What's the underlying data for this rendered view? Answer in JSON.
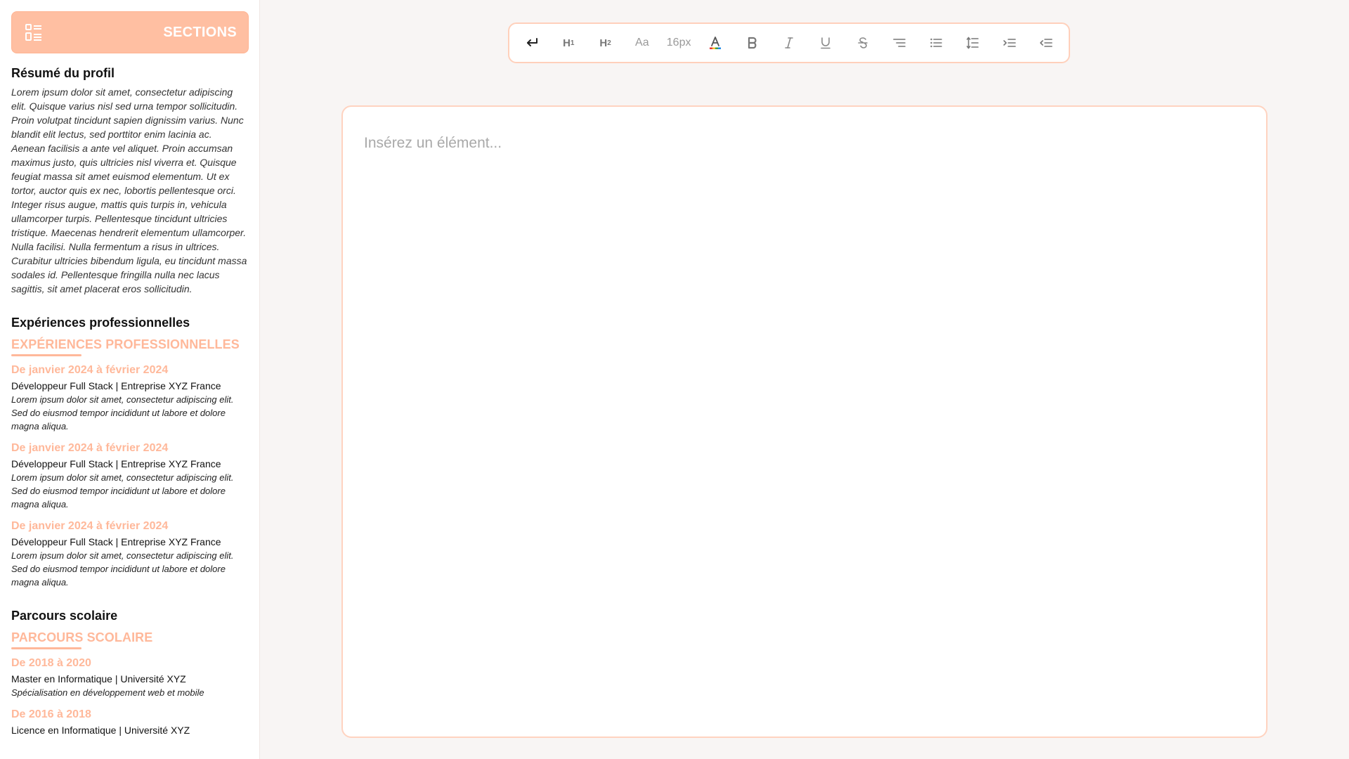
{
  "sidebar": {
    "sections_label": "SECTIONS",
    "profile": {
      "title": "Résumé du profil",
      "text": "Lorem ipsum dolor sit amet, consectetur adipiscing elit. Quisque varius nisl sed urna tempor sollicitudin. Proin volutpat tincidunt sapien dignissim varius. Nunc blandit elit lectus, sed porttitor enim lacinia ac. Aenean facilisis a ante vel aliquet. Proin accumsan maximus justo, quis ultricies nisl viverra et. Quisque feugiat massa sit amet euismod elementum. Ut ex tortor, auctor quis ex nec, lobortis pellentesque orci. Integer risus augue, mattis quis turpis in, vehicula ullamcorper turpis. Pellentesque tincidunt ultricies tristique. Maecenas hendrerit elementum ullamcorper. Nulla facilisi. Nulla fermentum a risus in ultrices. Curabitur ultricies bibendum ligula, eu tincidunt massa sodales id. Pellentesque fringilla nulla nec lacus sagittis, sit amet placerat eros sollicitudin."
    },
    "experience": {
      "title": "Expériences professionnelles",
      "heading": "EXPÉRIENCES PROFESSIONNELLES",
      "entries": [
        {
          "date": "De janvier 2024 à février 2024",
          "role": "Développeur Full Stack | Entreprise XYZ France",
          "desc": "Lorem ipsum dolor sit amet, consectetur adipiscing elit. Sed do eiusmod tempor incididunt ut labore et dolore magna aliqua."
        },
        {
          "date": "De janvier 2024 à février 2024",
          "role": "Développeur Full Stack | Entreprise XYZ France",
          "desc": "Lorem ipsum dolor sit amet, consectetur adipiscing elit. Sed do eiusmod tempor incididunt ut labore et dolore magna aliqua."
        },
        {
          "date": "De janvier 2024 à février 2024",
          "role": "Développeur Full Stack | Entreprise XYZ France",
          "desc": "Lorem ipsum dolor sit amet, consectetur adipiscing elit. Sed do eiusmod tempor incididunt ut labore et dolore magna aliqua."
        }
      ]
    },
    "education": {
      "title": "Parcours scolaire",
      "heading": "PARCOURS SCOLAIRE",
      "entries": [
        {
          "date": "De 2018 à 2020",
          "role": "Master en Informatique | Université XYZ",
          "desc": "Spécialisation en développement web et mobile"
        },
        {
          "date": "De 2016 à 2018",
          "role": "Licence en Informatique | Université XYZ"
        }
      ]
    }
  },
  "toolbar": {
    "h1_label": "H",
    "h1_sub": "1",
    "h2_label": "H",
    "h2_sub": "2",
    "font_label": "Aa",
    "size_label": "16px",
    "icons": [
      "undo-icon",
      "h1-icon",
      "h2-icon",
      "font-family-icon",
      "font-size-icon",
      "text-color-icon",
      "bold-icon",
      "italic-icon",
      "underline-icon",
      "strikethrough-icon",
      "align-icon",
      "bullet-list-icon",
      "line-height-icon",
      "indent-icon",
      "outdent-icon"
    ]
  },
  "editor": {
    "placeholder": "Insérez un élément..."
  },
  "colors": {
    "accent": "#ffb89a",
    "button_bg": "#ffbfa2",
    "border": "#ffd0bb",
    "page_bg": "#f8f5f4"
  }
}
